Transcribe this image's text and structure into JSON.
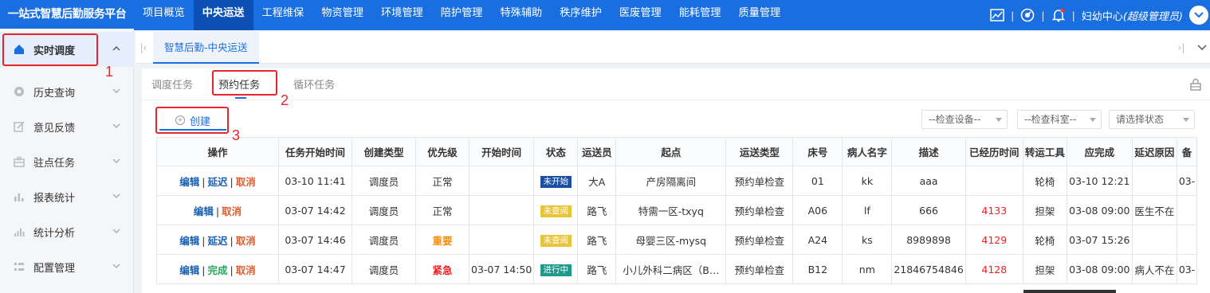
{
  "app": {
    "brand": "一站式智慧后勤服务平台"
  },
  "nav": [
    "项目概览",
    "中央运送",
    "工程维保",
    "物资管理",
    "环境管理",
    "陪护管理",
    "特殊辅助",
    "秩序维护",
    "医废管理",
    "能耗管理",
    "质量管理"
  ],
  "nav_active": "中央运送",
  "topright": {
    "sep": "|",
    "user_prefix": "妇幼中心",
    "user_role": "(超级管理员)"
  },
  "sidebar": {
    "items": [
      {
        "label": "实时调度"
      },
      {
        "label": "历史查询"
      },
      {
        "label": "意见反馈"
      },
      {
        "label": "驻点任务"
      },
      {
        "label": "报表统计"
      },
      {
        "label": "统计分析"
      },
      {
        "label": "配置管理"
      }
    ]
  },
  "breadcrumb": "智慧后勤-中央运送",
  "subtabs": [
    "调度任务",
    "预约任务",
    "循环任务"
  ],
  "toolbar": {
    "create": "创建",
    "filter_device": "--检查设备--",
    "filter_dept": "--检查科室--",
    "filter_status": "请选择状态"
  },
  "table": {
    "headers": [
      "操作",
      "任务开始时间",
      "创建类型",
      "优先级",
      "开始时间",
      "状态",
      "运送员",
      "起点",
      "运送类型",
      "床号",
      "病人名字",
      "描述",
      "已经历时间",
      "转运工具",
      "应完成",
      "延迟原因",
      "备"
    ],
    "action_labels": {
      "edit": "编辑",
      "delay": "延迟",
      "cancel": "取消",
      "finish": "完成",
      "sep": "|"
    },
    "rows": [
      {
        "start": "03-10 11:41",
        "create_type": "调度员",
        "priority": "正常",
        "begin": "",
        "status": "未开始",
        "porter": "大A",
        "origin": "产房隔离间",
        "transport": "预约单检查",
        "bed": "01",
        "patient": "kk",
        "desc": "aaa",
        "elapsed": "",
        "tool": "轮椅",
        "due": "03-10 12:21",
        "delay_reason": "",
        "extra": "03-"
      },
      {
        "start": "03-07 14:42",
        "create_type": "调度员",
        "priority": "正常",
        "begin": "",
        "status": "未查阅",
        "porter": "路飞",
        "origin": "特需一区-txyq",
        "transport": "预约单检查",
        "bed": "A06",
        "patient": "lf",
        "desc": "666",
        "elapsed": "4133",
        "tool": "担架",
        "due": "03-08 09:00",
        "delay_reason": "医生不在",
        "extra": ""
      },
      {
        "start": "03-07 14:46",
        "create_type": "调度员",
        "priority": "重要",
        "begin": "",
        "status": "未查阅",
        "porter": "路飞",
        "origin": "母婴三区-mysq",
        "transport": "预约单检查",
        "bed": "A24",
        "patient": "ks",
        "desc": "8989898",
        "elapsed": "4129",
        "tool": "轮椅",
        "due": "03-07 15:26",
        "delay_reason": "",
        "extra": ""
      },
      {
        "start": "03-07 14:47",
        "create_type": "调度员",
        "priority": "紧急",
        "begin": "03-07 14:50",
        "status": "进行中",
        "porter": "路飞",
        "origin": "小儿外科二病区（B…",
        "transport": "预约单检查",
        "bed": "B12",
        "patient": "nm",
        "desc": "21846754846",
        "elapsed": "4128",
        "tool": "担架",
        "due": "03-08 09:00",
        "delay_reason": "病人不在",
        "extra": "03-"
      }
    ]
  },
  "annotations": [
    "1",
    "2",
    "3"
  ],
  "colors": {
    "topbar": "#1a6fe0",
    "not_started": "#1a4fa3",
    "unread": "#e8c43a",
    "in_progress": "#1f9a8a",
    "annotation": "#e8242c"
  }
}
